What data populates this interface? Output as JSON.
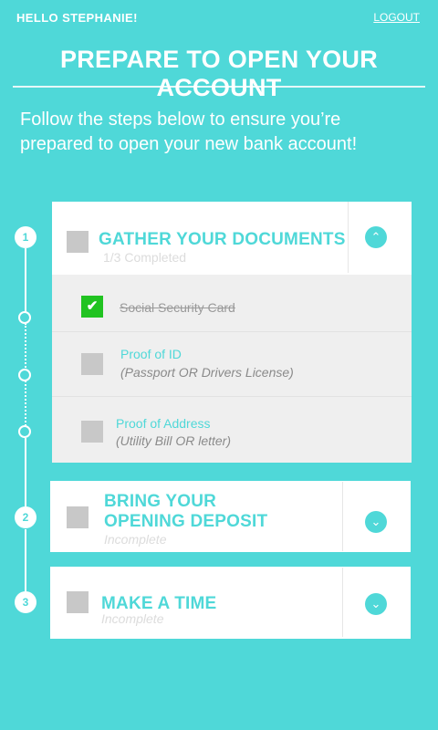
{
  "header": {
    "greeting": "HELLO STEPHANIE!",
    "logout_label": "LOGOUT"
  },
  "page": {
    "title": "PREPARE TO OPEN YOUR ACCOUNT",
    "intro_line1": "Follow the steps below to ensure you’re",
    "intro_line2": "prepared to open your new bank account!"
  },
  "colors": {
    "background": "#4fd8d8",
    "accent": "#4fd8d8",
    "check_done": "#21c321",
    "card": "#ffffff",
    "subpanel": "#efefef"
  },
  "steps": [
    {
      "number": "1",
      "title": "GATHER YOUR DOCUMENTS",
      "status": "1/3 Completed",
      "expanded": true,
      "toggle_icon": "chevron-up-icon",
      "items": [
        {
          "label": "Social Security Card",
          "hint": "",
          "completed": true
        },
        {
          "label": "Proof of ID",
          "hint": "(Passport OR Drivers License)",
          "completed": false
        },
        {
          "label": "Proof of Address",
          "hint": "(Utility Bill OR letter)",
          "completed": false
        }
      ]
    },
    {
      "number": "2",
      "title_line1": "BRING YOUR",
      "title_line2": "OPENING DEPOSIT",
      "status": "Incomplete",
      "expanded": false,
      "toggle_icon": "chevron-down-icon"
    },
    {
      "number": "3",
      "title": "MAKE A TIME",
      "status": "Incomplete",
      "expanded": false,
      "toggle_icon": "chevron-down-icon"
    }
  ]
}
